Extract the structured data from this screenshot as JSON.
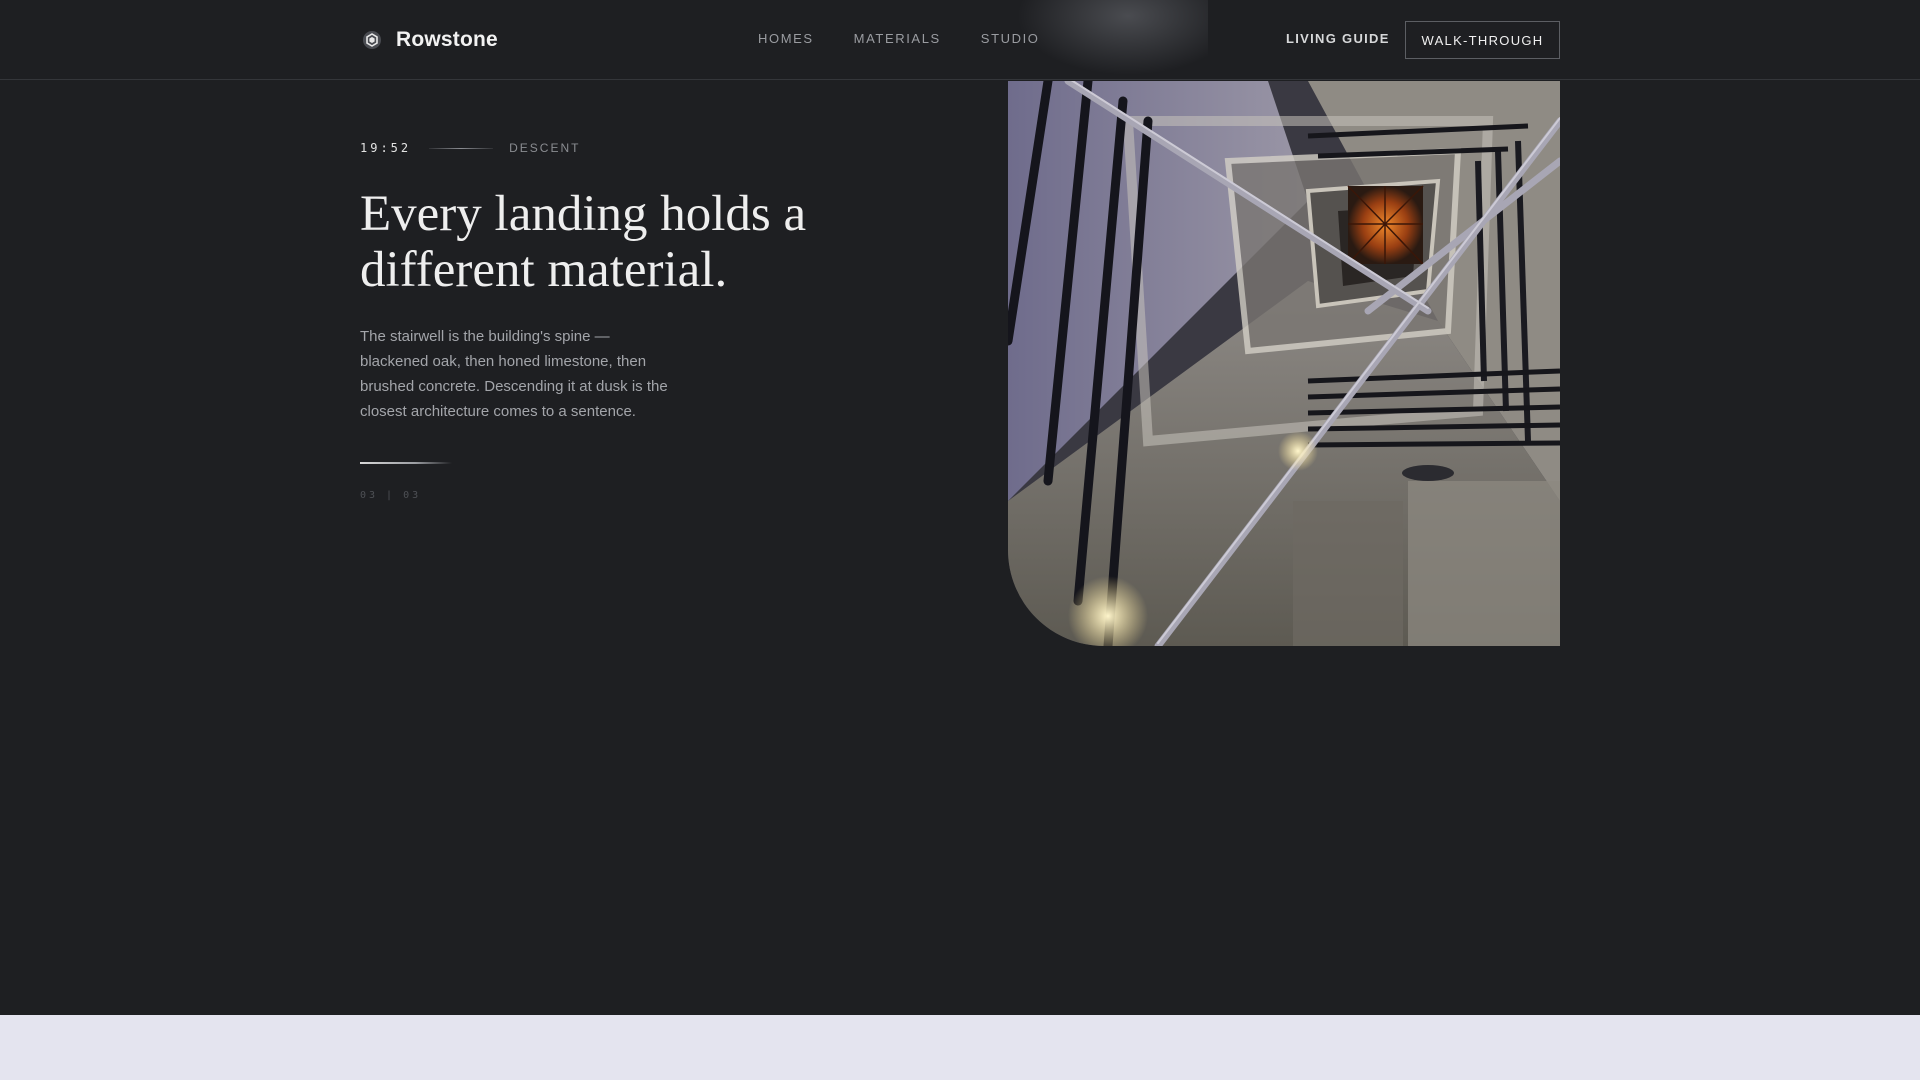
{
  "brand": {
    "name": "Rowstone",
    "icon": "hex-logo-icon"
  },
  "nav": {
    "items": [
      "HOMES",
      "MATERIALS",
      "STUDIO"
    ]
  },
  "header_actions": {
    "living_guide": "LIVING GUIDE",
    "walk_through": "WALK-THROUGH"
  },
  "hero": {
    "time": "19:52",
    "label": "DESCENT",
    "headline": "Every landing holds a different material.",
    "body": "The stairwell is the building's spine — blackened oak, then honed limestone, then brushed concrete. Descending it at dusk is the closest architecture comes to a sentence.",
    "counter": {
      "current": "03",
      "separator": "|",
      "total": "03"
    }
  },
  "image": {
    "subject": "stairwell-photo"
  },
  "colors": {
    "background": "#1e1f22",
    "divider": "#34363a",
    "accent_light": "#e4e4ef",
    "text_primary": "#eeeeee",
    "text_muted": "#a3a5aa"
  }
}
